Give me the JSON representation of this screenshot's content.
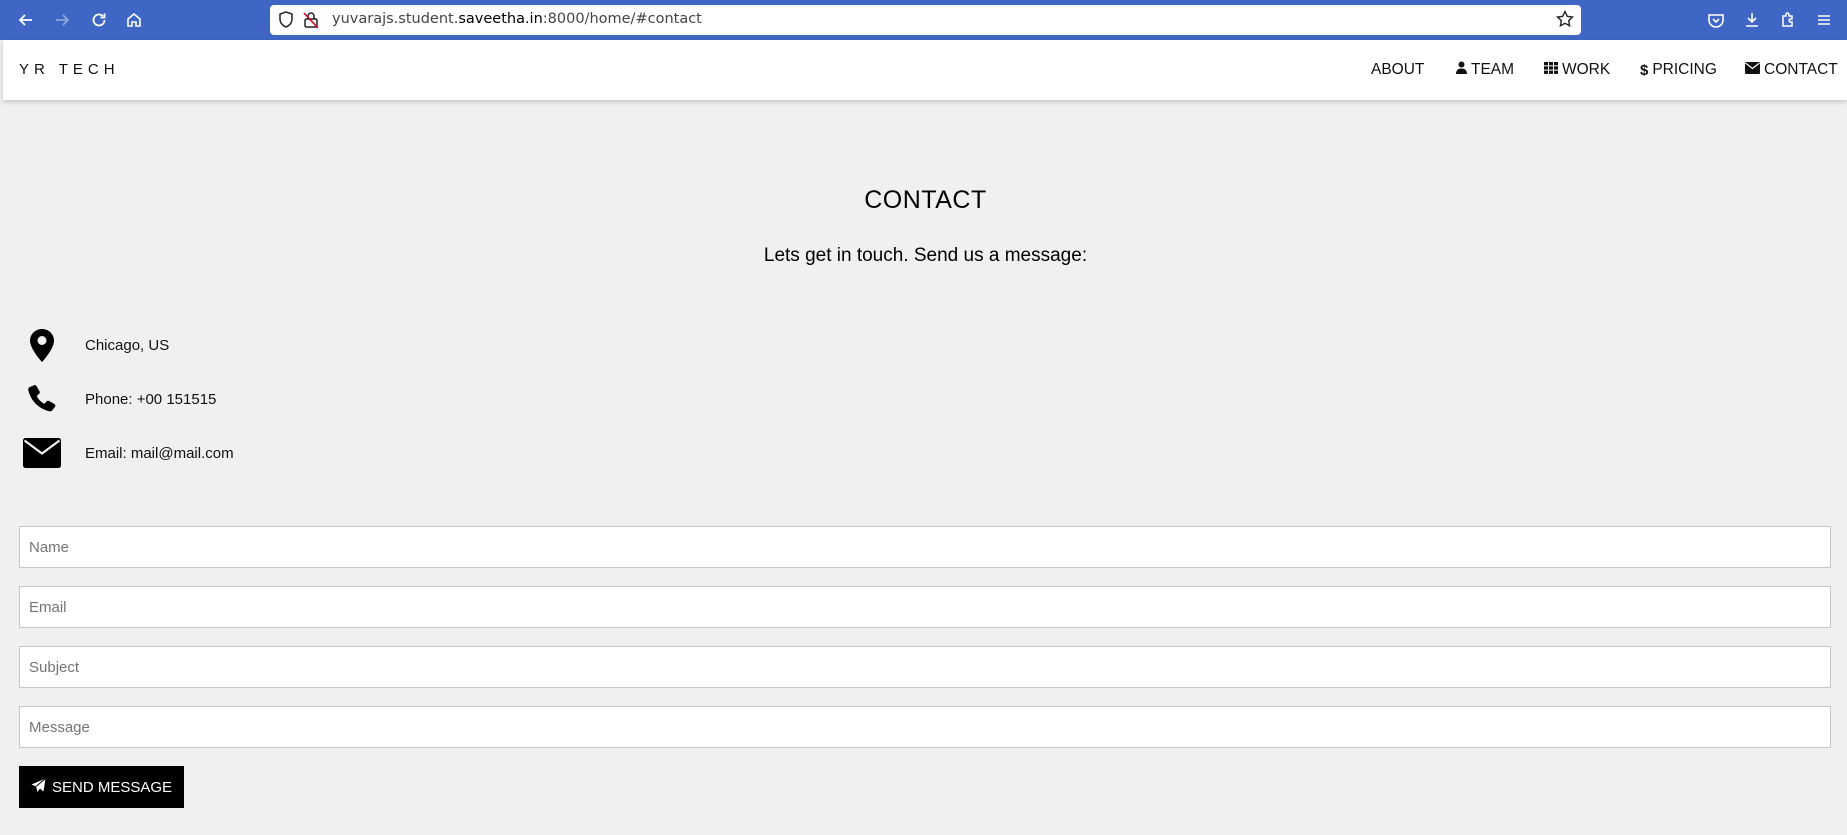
{
  "browser": {
    "url_host_prefix": "yuvarajs.student.",
    "url_host": "saveetha.in",
    "url_rest": ":8000/home/#contact"
  },
  "header": {
    "brand": "YR TECH",
    "nav": [
      {
        "label": "ABOUT",
        "icon": ""
      },
      {
        "label": "TEAM",
        "icon": "user-icon"
      },
      {
        "label": "WORK",
        "icon": "grid-icon"
      },
      {
        "label": "PRICING",
        "icon": "dollar-icon"
      },
      {
        "label": "CONTACT",
        "icon": "envelope-icon"
      }
    ]
  },
  "contact": {
    "title": "CONTACT",
    "subtitle": "Lets get in touch. Send us a message:",
    "info": [
      {
        "icon": "map-marker-icon",
        "text": "Chicago, US"
      },
      {
        "icon": "phone-icon",
        "text": "Phone: +00 151515"
      },
      {
        "icon": "envelope-icon",
        "text": "Email: mail@mail.com"
      }
    ],
    "form": {
      "name_placeholder": "Name",
      "email_placeholder": "Email",
      "subject_placeholder": "Subject",
      "message_placeholder": "Message",
      "submit_label": "SEND MESSAGE",
      "submit_icon": "paper-plane-icon"
    }
  }
}
